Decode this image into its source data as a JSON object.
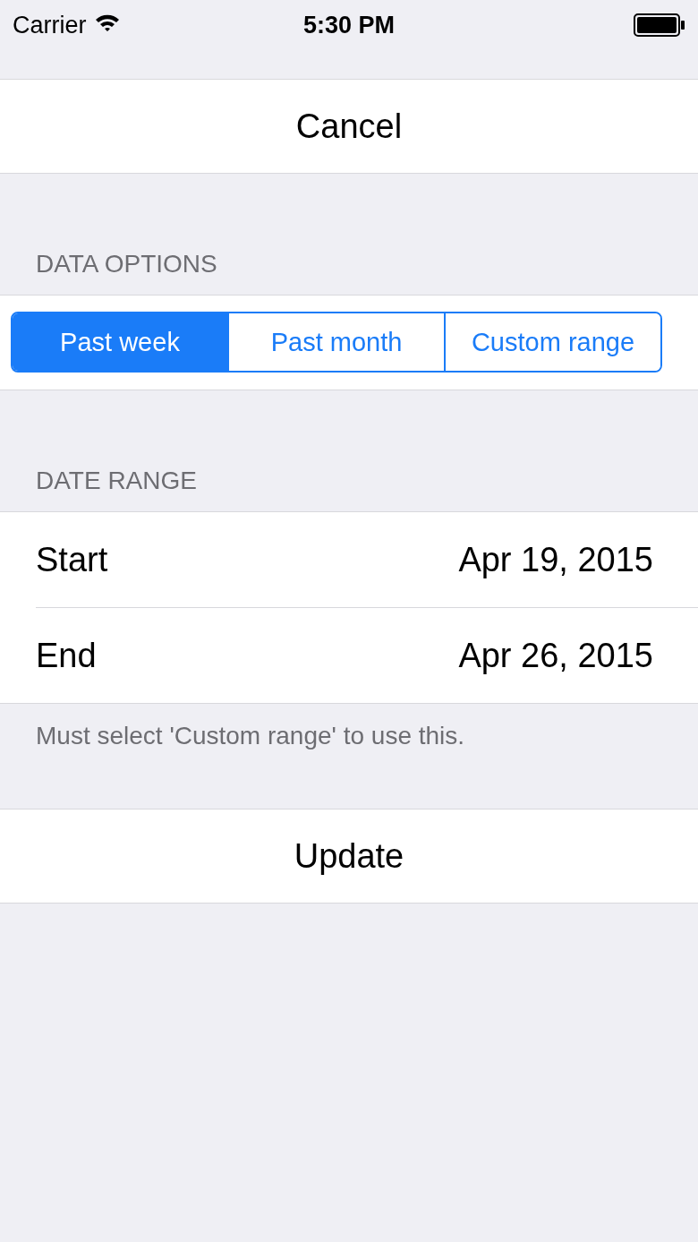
{
  "status_bar": {
    "carrier": "Carrier",
    "time": "5:30 PM"
  },
  "cancel_button": "Cancel",
  "data_options": {
    "header": "DATA OPTIONS",
    "segments": [
      {
        "label": "Past week",
        "selected": true
      },
      {
        "label": "Past month",
        "selected": false
      },
      {
        "label": "Custom range",
        "selected": false
      }
    ]
  },
  "date_range": {
    "header": "DATE RANGE",
    "rows": [
      {
        "label": "Start",
        "value": "Apr 19, 2015"
      },
      {
        "label": "End",
        "value": "Apr 26, 2015"
      }
    ],
    "footer": "Must select 'Custom range' to use this."
  },
  "update_button": "Update"
}
